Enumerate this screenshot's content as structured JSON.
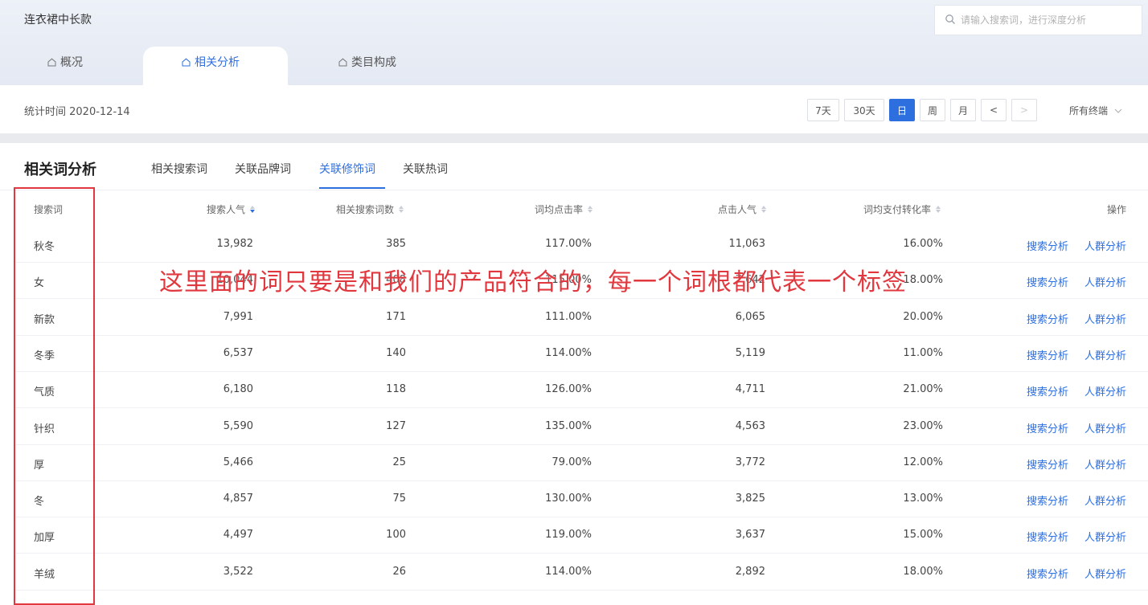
{
  "header": {
    "title": "连衣裙中长款",
    "search_placeholder": "请输入搜索词，进行深度分析",
    "tabs": [
      {
        "label": "概况",
        "icon": "home-icon"
      },
      {
        "label": "相关分析",
        "icon": "home-icon",
        "active": true
      },
      {
        "label": "类目构成",
        "icon": "home-icon"
      }
    ]
  },
  "statbar": {
    "time_label": "统计时间 2020-12-14",
    "periods": [
      {
        "label": "7天"
      },
      {
        "label": "30天"
      },
      {
        "label": "日",
        "active": true
      },
      {
        "label": "周"
      },
      {
        "label": "月"
      }
    ],
    "prev": "<",
    "next": ">",
    "terminal": "所有终端"
  },
  "section": {
    "title": "相关词分析",
    "tabs": [
      {
        "label": "相关搜索词"
      },
      {
        "label": "关联品牌词"
      },
      {
        "label": "关联修饰词",
        "active": true
      },
      {
        "label": "关联热词"
      }
    ]
  },
  "table": {
    "headers": {
      "keyword": "搜索词",
      "search_pop": "搜索人气",
      "related_count": "相关搜索词数",
      "ctr": "词均点击率",
      "click_pop": "点击人气",
      "conversion": "词均支付转化率",
      "action": "操作"
    },
    "rows": [
      {
        "keyword": "秋冬",
        "search_pop": "13,982",
        "related_count": "385",
        "ctr": "117.00%",
        "click_pop": "11,063",
        "conversion": "16.00%"
      },
      {
        "keyword": "女",
        "search_pop": "10,044",
        "related_count": "408",
        "ctr": "115.00%",
        "click_pop": "7,642",
        "conversion": "18.00%"
      },
      {
        "keyword": "新款",
        "search_pop": "7,991",
        "related_count": "171",
        "ctr": "111.00%",
        "click_pop": "6,065",
        "conversion": "20.00%"
      },
      {
        "keyword": "冬季",
        "search_pop": "6,537",
        "related_count": "140",
        "ctr": "114.00%",
        "click_pop": "5,119",
        "conversion": "11.00%"
      },
      {
        "keyword": "气质",
        "search_pop": "6,180",
        "related_count": "118",
        "ctr": "126.00%",
        "click_pop": "4,711",
        "conversion": "21.00%"
      },
      {
        "keyword": "针织",
        "search_pop": "5,590",
        "related_count": "127",
        "ctr": "135.00%",
        "click_pop": "4,563",
        "conversion": "23.00%"
      },
      {
        "keyword": "厚",
        "search_pop": "5,466",
        "related_count": "25",
        "ctr": "79.00%",
        "click_pop": "3,772",
        "conversion": "12.00%"
      },
      {
        "keyword": "冬",
        "search_pop": "4,857",
        "related_count": "75",
        "ctr": "130.00%",
        "click_pop": "3,825",
        "conversion": "13.00%"
      },
      {
        "keyword": "加厚",
        "search_pop": "4,497",
        "related_count": "100",
        "ctr": "119.00%",
        "click_pop": "3,637",
        "conversion": "15.00%"
      },
      {
        "keyword": "羊绒",
        "search_pop": "3,522",
        "related_count": "26",
        "ctr": "114.00%",
        "click_pop": "2,892",
        "conversion": "18.00%"
      }
    ],
    "action_search": "搜索分析",
    "action_crowd": "人群分析"
  },
  "annotation": "这里面的词只要是和我们的产品符合的，每一个词根都代表一个标签",
  "colors": {
    "accent": "#2e6fe0",
    "annotation_red": "#e0383e"
  }
}
